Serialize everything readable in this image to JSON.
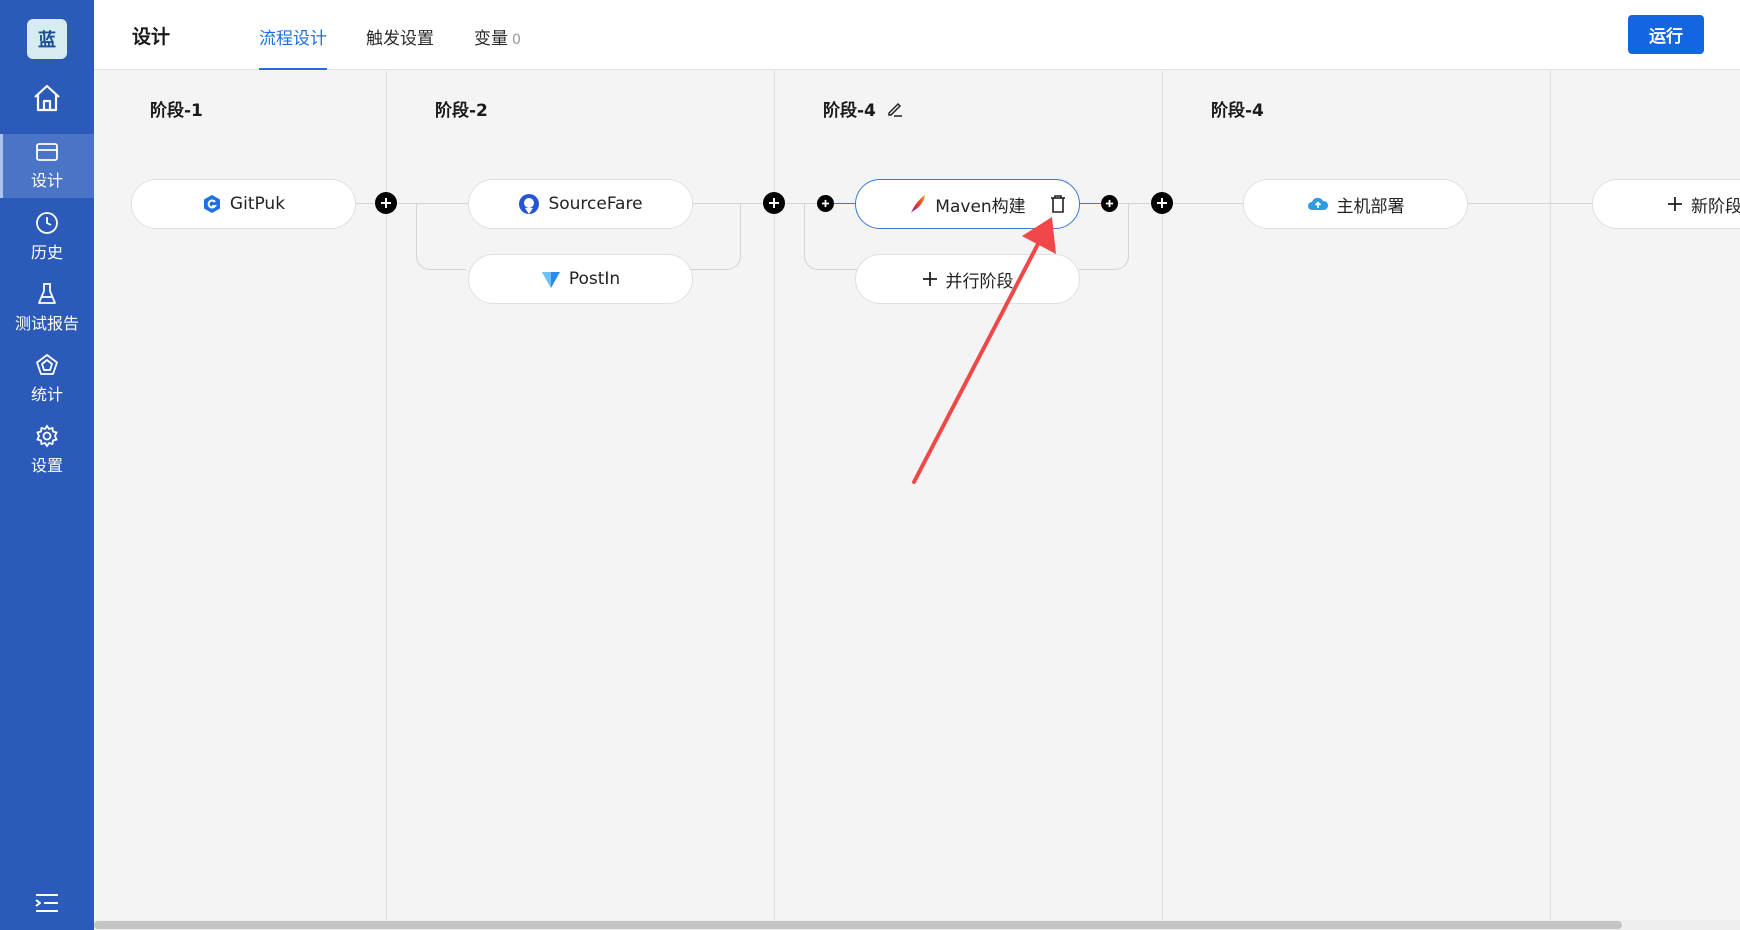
{
  "sidebar": {
    "logo": "蓝",
    "items": [
      {
        "label": "设计",
        "icon": "design-card-icon",
        "active": true
      },
      {
        "label": "历史",
        "icon": "clock-icon"
      },
      {
        "label": "测试报告",
        "icon": "flask-icon"
      },
      {
        "label": "统计",
        "icon": "pentagon-chart-icon"
      },
      {
        "label": "设置",
        "icon": "gear-icon"
      }
    ],
    "home_icon": "home-icon",
    "collapse_icon": "collapse-menu-icon"
  },
  "header": {
    "title": "设计",
    "tabs": [
      {
        "label": "流程设计",
        "active": true
      },
      {
        "label": "触发设置"
      },
      {
        "label": "变量",
        "count": "0"
      }
    ],
    "run_label": "运行"
  },
  "stages": [
    {
      "title": "阶段-1",
      "tasks": [
        {
          "name": "GitPuk",
          "icon": "gitpuk-icon"
        }
      ]
    },
    {
      "title": "阶段-2",
      "tasks": [
        {
          "name": "SourceFare",
          "icon": "sourcefare-icon"
        },
        {
          "name": "PostIn",
          "icon": "postin-icon"
        }
      ]
    },
    {
      "title": "阶段-4",
      "editable": true,
      "tasks": [
        {
          "name": "Maven构建",
          "icon": "maven-feather-icon",
          "selected": true
        }
      ],
      "add_parallel_label": "并行阶段"
    },
    {
      "title": "阶段-4",
      "tasks": [
        {
          "name": "主机部署",
          "icon": "cloud-deploy-icon"
        }
      ]
    }
  ],
  "new_stage_label": "新阶段",
  "colors": {
    "sidebar_bg": "#2c5ab8",
    "accent": "#1e6fe0",
    "run_button": "#1365e0",
    "annotation_arrow": "#f04848"
  }
}
